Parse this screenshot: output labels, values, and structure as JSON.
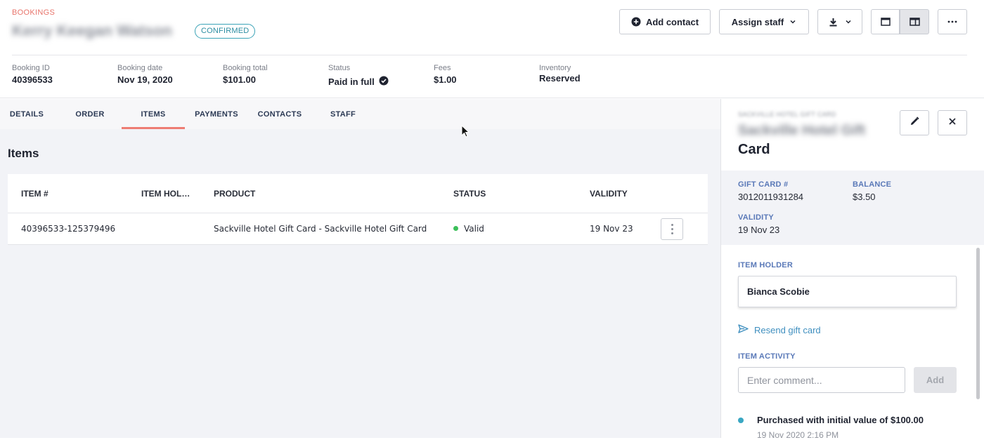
{
  "header": {
    "breadcrumb": "BOOKINGS",
    "customer_name": "Kerry Keegan Watson",
    "status_pill": "CONFIRMED",
    "buttons": {
      "add_contact": "Add contact",
      "assign_staff": "Assign staff"
    }
  },
  "summary": [
    {
      "label": "Booking ID",
      "value": "40396533"
    },
    {
      "label": "Booking date",
      "value": "Nov 19, 2020"
    },
    {
      "label": "Booking total",
      "value": "$101.00"
    },
    {
      "label": "Status",
      "value": "Paid in full"
    },
    {
      "label": "Fees",
      "value": "$1.00"
    },
    {
      "label": "Inventory",
      "value": "Reserved"
    }
  ],
  "tabs": [
    {
      "label": "DETAILS"
    },
    {
      "label": "ORDER"
    },
    {
      "label": "ITEMS",
      "active": true
    },
    {
      "label": "PAYMENTS"
    },
    {
      "label": "CONTACTS"
    },
    {
      "label": "STAFF"
    }
  ],
  "items_section": {
    "title": "Items",
    "columns": [
      "ITEM #",
      "ITEM HOL…",
      "PRODUCT",
      "STATUS",
      "VALIDITY"
    ],
    "rows": [
      {
        "item_number": "40396533-125379496",
        "item_holder": "",
        "product": "Sackville Hotel Gift Card - Sackville Hotel Gift Card",
        "status": "Valid",
        "validity": "19 Nov 23"
      }
    ]
  },
  "panel": {
    "subtitle": "SACKVILLE HOTEL GIFT CARD",
    "title_blurred": "Sackville Hotel Gift",
    "title_tail": "Card",
    "details": {
      "gift_card_label": "GIFT CARD #",
      "gift_card_value": "3012011931284",
      "balance_label": "BALANCE",
      "balance_value": "$3.50",
      "validity_label": "VALIDITY",
      "validity_value": "19 Nov 23"
    },
    "item_holder_label": "ITEM HOLDER",
    "item_holder_value": "Bianca Scobie",
    "resend_label": "Resend gift card",
    "activity_label": "ITEM ACTIVITY",
    "comment_placeholder": "Enter comment...",
    "add_label": "Add",
    "activity": [
      {
        "text": "Purchased with initial value of $100.00",
        "time": "19 Nov 2020 2:16 PM"
      }
    ]
  },
  "colors": {
    "accent": "#ee7d73",
    "status_valid": "#3cbf5a",
    "link": "#3f8fbf",
    "pill": "#3ba3b7"
  },
  "icons": [
    "plus-circle-icon",
    "chevron-down-icon",
    "download-icon",
    "single-pane-icon",
    "split-pane-icon",
    "more-icon",
    "check-circle-icon",
    "kebab-icon",
    "pencil-icon",
    "close-icon",
    "send-icon",
    "cursor-icon"
  ]
}
